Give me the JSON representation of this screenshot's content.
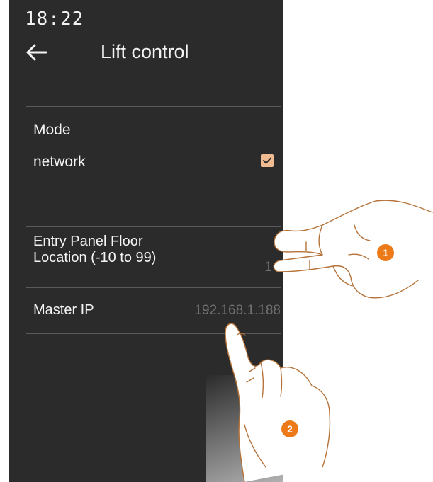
{
  "status": {
    "time": "18:22"
  },
  "header": {
    "title": "Lift control"
  },
  "mode": {
    "label": "Mode",
    "option_label": "network",
    "checked": true
  },
  "rows": [
    {
      "label": "Entry Panel Floor\nLocation (-10 to 99)",
      "value": "1"
    },
    {
      "label": "Master IP",
      "value": "192.168.1.188"
    }
  ],
  "annotations": [
    "1",
    "2"
  ],
  "colors": {
    "screen_bg": "#2b2b2b",
    "accent_checkbox": "#f1bc92",
    "annotation_badge": "#ec7a18",
    "value_text": "#707070"
  }
}
